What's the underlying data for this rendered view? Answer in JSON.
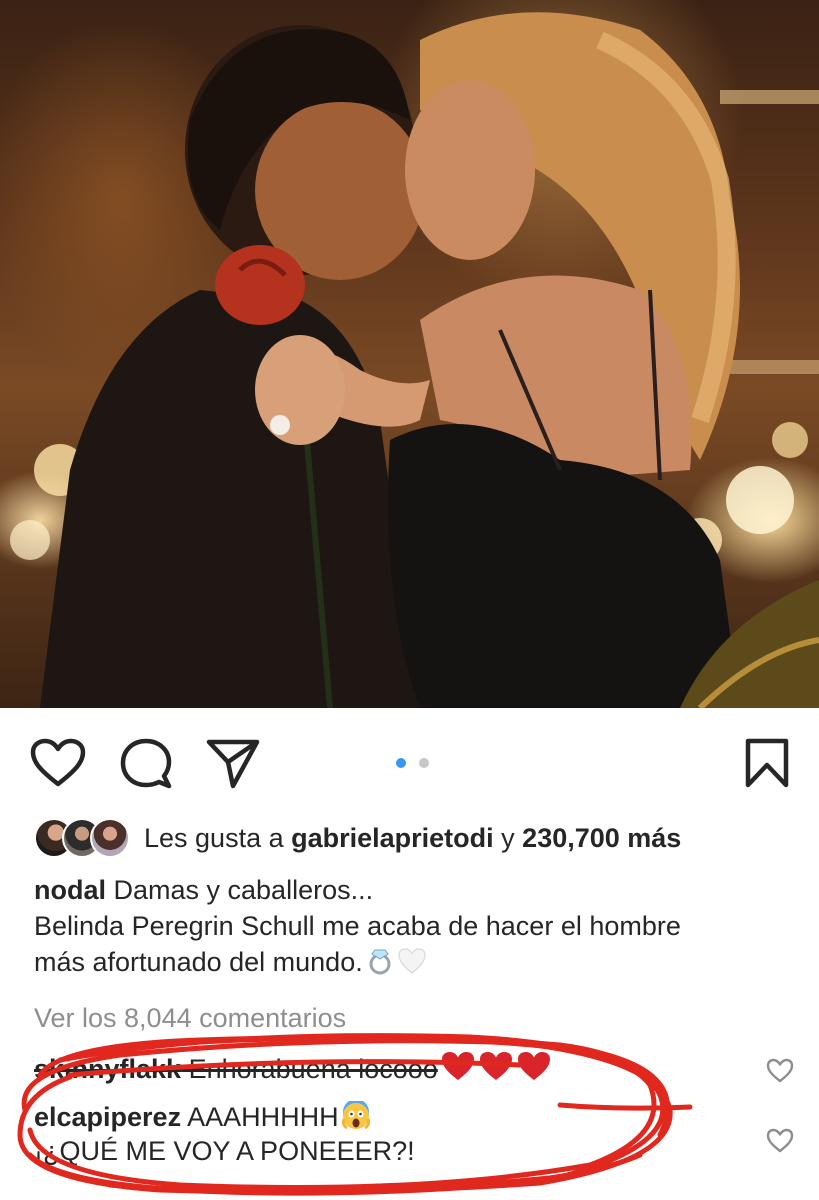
{
  "post": {
    "photo_alt": "",
    "carousel": {
      "count": 2,
      "active_index": 0
    },
    "accent": "#3897f0",
    "likes": {
      "prefix": "Les gusta a ",
      "user": "gabrielaprietodi",
      "connector": " y ",
      "count": "230,700 más"
    },
    "caption": {
      "username": "nodal",
      "line1": " Damas y caballeros...",
      "line2": "Belinda Peregrin Schull me acaba de hacer el hombre",
      "line3": "más afortunado del mundo."
    },
    "view_comments": "Ver los 8,044 comentarios",
    "comments": [
      {
        "username": "skinnyflakk",
        "text": " Enhorabuena locooo"
      },
      {
        "username": "elcapiperez",
        "text": " AAAHHHHH",
        "line2": "¡¿QUÉ ME VOY A PONEEER?!"
      }
    ],
    "icons": [
      "heart-icon",
      "comment-bubble-icon",
      "share-paper-plane-icon",
      "bookmark-icon",
      "ring-emoji",
      "white-heart-emoji",
      "red-heart-emoji",
      "screaming-face-emoji"
    ],
    "annotation_color": "#e0281f"
  }
}
